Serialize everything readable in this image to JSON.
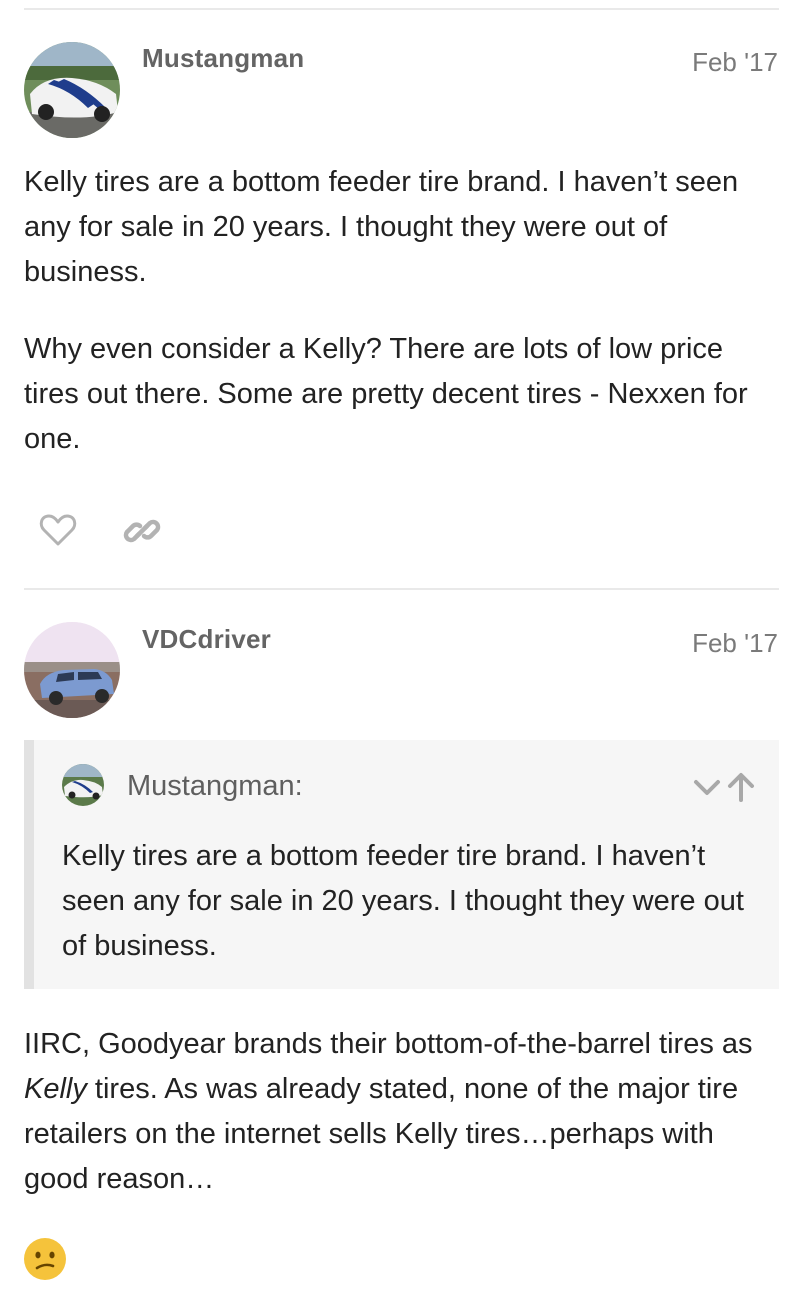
{
  "posts": [
    {
      "username": "Mustangman",
      "date": "Feb '17",
      "avatar": "mustang-car-avatar",
      "paragraphs": [
        "Kelly tires are a bottom feeder tire brand. I haven’t seen any for sale in 20 years. I thought they were out of business.",
        "Why even consider a Kelly? There are lots of low price tires out there. Some are pretty decent tires - Nexxen for one."
      ],
      "actions": [
        "heart-icon",
        "link-icon"
      ]
    },
    {
      "username": "VDCdriver",
      "date": "Feb '17",
      "avatar": "blue-wagon-avatar",
      "quote": {
        "author": "Mustangman:",
        "text": "Kelly tires are a bottom feeder tire brand. I haven’t seen any for sale in 20 years. I thought they were out of business.",
        "controls": [
          "chevron-down-icon",
          "arrow-up-icon"
        ]
      },
      "reply_before_em": "IIRC, Goodyear brands their bottom-of-the-barrel tires as ",
      "reply_em": "Kelly",
      "reply_after_em": " tires. As was already stated, none of the major tire retailers on the internet sells Kelly tires…perhaps with good reason…",
      "emoji": "confused-face-icon"
    }
  ],
  "colors": {
    "text": "#222222",
    "username": "#646464",
    "meta": "#7a7a7a",
    "divider": "#e9e9e9",
    "quote_bg": "#f6f6f6",
    "quote_border": "#e2e2e2",
    "icon": "#b3b3b3"
  }
}
